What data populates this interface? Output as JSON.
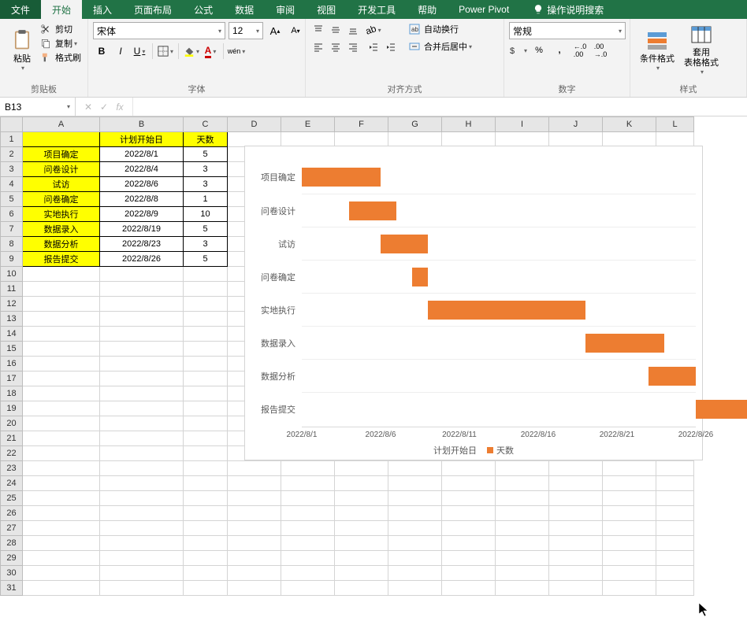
{
  "menu": {
    "file": "文件",
    "tabs": [
      "开始",
      "插入",
      "页面布局",
      "公式",
      "数据",
      "审阅",
      "视图",
      "开发工具",
      "帮助",
      "Power Pivot"
    ],
    "search": "操作说明搜索"
  },
  "ribbon": {
    "clipboard": {
      "title": "剪贴板",
      "paste": "粘贴",
      "cut": "剪切",
      "copy": "复制",
      "format_painter": "格式刷"
    },
    "font": {
      "title": "字体",
      "name": "宋体",
      "size": "12",
      "bold": "B",
      "italic": "I",
      "underline": "U",
      "pinyin": "wén"
    },
    "align": {
      "title": "对齐方式",
      "wrap": "自动换行",
      "merge": "合并后居中"
    },
    "number": {
      "title": "数字",
      "format": "常规",
      "pct": "%",
      "comma": ",",
      "inc": ".0",
      "dec": ".00"
    },
    "styles": {
      "title": "样式",
      "cond": "条件格式",
      "table": "套用\n表格格式"
    }
  },
  "namebox": "B13",
  "columns": [
    "A",
    "B",
    "C",
    "D",
    "E",
    "F",
    "G",
    "H",
    "I",
    "J",
    "K",
    "L"
  ],
  "headers": {
    "A": "",
    "B": "计划开始日",
    "C": "天数"
  },
  "table": [
    {
      "name": "项目确定",
      "start": "2022/8/1",
      "days": "5"
    },
    {
      "name": "问卷设计",
      "start": "2022/8/4",
      "days": "3"
    },
    {
      "name": "试访",
      "start": "2022/8/6",
      "days": "3"
    },
    {
      "name": "问卷确定",
      "start": "2022/8/8",
      "days": "1"
    },
    {
      "name": "实地执行",
      "start": "2022/8/9",
      "days": "10"
    },
    {
      "name": "数据录入",
      "start": "2022/8/19",
      "days": "5"
    },
    {
      "name": "数据分析",
      "start": "2022/8/23",
      "days": "3"
    },
    {
      "name": "报告提交",
      "start": "2022/8/26",
      "days": "5"
    }
  ],
  "chart_data": {
    "type": "bar",
    "orientation": "horizontal",
    "categories": [
      "项目确定",
      "问卷设计",
      "试访",
      "问卷确定",
      "实地执行",
      "数据录入",
      "数据分析",
      "报告提交"
    ],
    "series": [
      {
        "name": "计划开始日",
        "values": [
          0,
          3,
          5,
          7,
          8,
          18,
          22,
          25
        ],
        "color": "transparent"
      },
      {
        "name": "天数",
        "values": [
          5,
          3,
          3,
          1,
          10,
          5,
          3,
          5
        ],
        "color": "#ed7d31"
      }
    ],
    "x_ticks": [
      "2022/8/1",
      "2022/8/6",
      "2022/8/11",
      "2022/8/16",
      "2022/8/21",
      "2022/8/26"
    ],
    "xlim_days": 25,
    "legend": [
      "计划开始日",
      "天数"
    ]
  }
}
